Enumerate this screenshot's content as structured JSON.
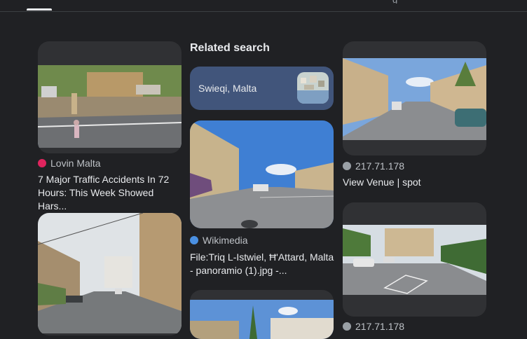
{
  "header": {
    "active_tab": "",
    "right_text": "g"
  },
  "results": [
    {
      "source": "Lovin Malta",
      "source_icon_color": "#e0245e",
      "title": "7 Major Traffic Accidents In 72 Hours: This Week Showed Hars..."
    },
    {
      "source": "Wikimedia",
      "source_icon_color": "#4a90e2",
      "title": "File:Triq L-Istwiel, Ħ'Attard, Malta - panoramio (1).jpg -..."
    },
    {
      "source": "217.71.178",
      "source_icon_color": "#9aa0a6",
      "title": "View Venue | spot"
    },
    {
      "source": "217.71.178",
      "source_icon_color": "#9aa0a6",
      "title": ""
    }
  ],
  "related": {
    "heading": "Related search",
    "chip_label": "Swieqi, Malta"
  },
  "colors": {
    "background": "#202124",
    "card": "#303134",
    "chip": "#41557b"
  }
}
